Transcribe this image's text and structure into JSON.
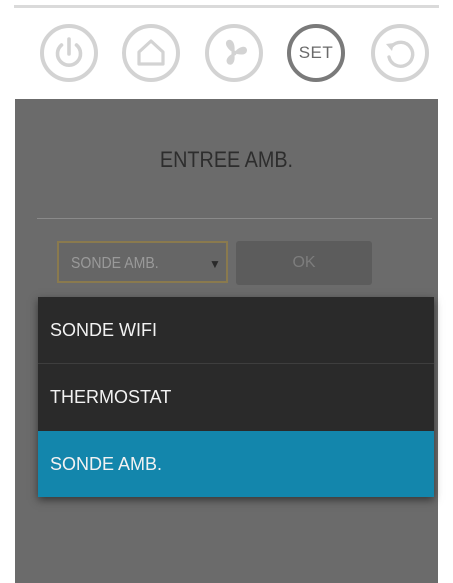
{
  "toolbar": {
    "items": [
      {
        "icon": "power-icon"
      },
      {
        "icon": "home-icon"
      },
      {
        "icon": "fan-icon"
      },
      {
        "icon": "set-icon",
        "label": "SET",
        "active": true
      },
      {
        "icon": "reset-icon"
      }
    ]
  },
  "panel": {
    "title": "ENTREE AMB.",
    "select": {
      "value": "SONDE AMB.",
      "arrow": "▼"
    },
    "ok_label": "OK"
  },
  "dropdown": {
    "options": [
      "SONDE WIFI",
      "THERMOSTAT",
      "SONDE AMB."
    ],
    "selected": "SONDE AMB."
  },
  "colors": {
    "panel_bg": "#6b6b6b",
    "selected_bg": "#1386ac",
    "menu_bg": "#2a2a2a",
    "icon_gray": "#d3d3d3"
  }
}
